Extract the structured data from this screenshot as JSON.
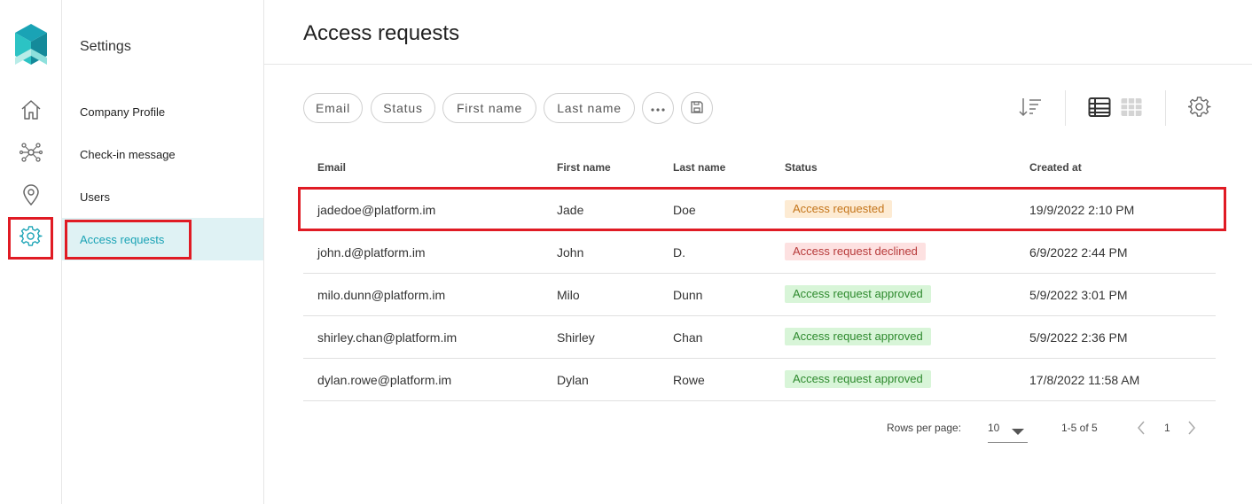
{
  "rail": {
    "items": [
      {
        "icon": "home-icon"
      },
      {
        "icon": "network-icon"
      },
      {
        "icon": "location-pin-icon"
      },
      {
        "icon": "gear-icon",
        "active": true
      }
    ]
  },
  "subnav": {
    "title": "Settings",
    "items": [
      {
        "label": "Company Profile"
      },
      {
        "label": "Check-in message"
      },
      {
        "label": "Users"
      },
      {
        "label": "Access requests",
        "active": true
      }
    ]
  },
  "header": {
    "title": "Access requests"
  },
  "filters": {
    "chips": [
      "Email",
      "Status",
      "First name",
      "Last name"
    ],
    "more_icon": "ellipsis-icon",
    "save_icon": "save-icon"
  },
  "toolbar": {
    "sort_icon": "sort-icon",
    "list_view_icon": "list-view-icon",
    "grid_view_icon": "grid-view-icon",
    "settings_icon": "gear-icon"
  },
  "table": {
    "columns": [
      "Email",
      "First name",
      "Last name",
      "Status",
      "Created at"
    ],
    "rows": [
      {
        "email": "jadedoe@platform.im",
        "first": "Jade",
        "last": "Doe",
        "status": "Access requested",
        "status_type": "requested",
        "created": "19/9/2022 2:10 PM"
      },
      {
        "email": "john.d@platform.im",
        "first": "John",
        "last": "D.",
        "status": "Access request declined",
        "status_type": "declined",
        "created": "6/9/2022 2:44 PM"
      },
      {
        "email": "milo.dunn@platform.im",
        "first": "Milo",
        "last": "Dunn",
        "status": "Access request approved",
        "status_type": "approved",
        "created": "5/9/2022 3:01 PM"
      },
      {
        "email": "shirley.chan@platform.im",
        "first": "Shirley",
        "last": "Chan",
        "status": "Access request approved",
        "status_type": "approved",
        "created": "5/9/2022 2:36 PM"
      },
      {
        "email": "dylan.rowe@platform.im",
        "first": "Dylan",
        "last": "Rowe",
        "status": "Access request approved",
        "status_type": "approved",
        "created": "17/8/2022 11:58 AM"
      }
    ]
  },
  "pagination": {
    "rows_per_page_label": "Rows per page:",
    "rows_per_page_value": "10",
    "range": "1-5 of 5",
    "page": "1"
  },
  "colors": {
    "accent": "#1aa3b5",
    "highlight": "#e01b24",
    "active_nav_bg": "#dff2f4"
  }
}
